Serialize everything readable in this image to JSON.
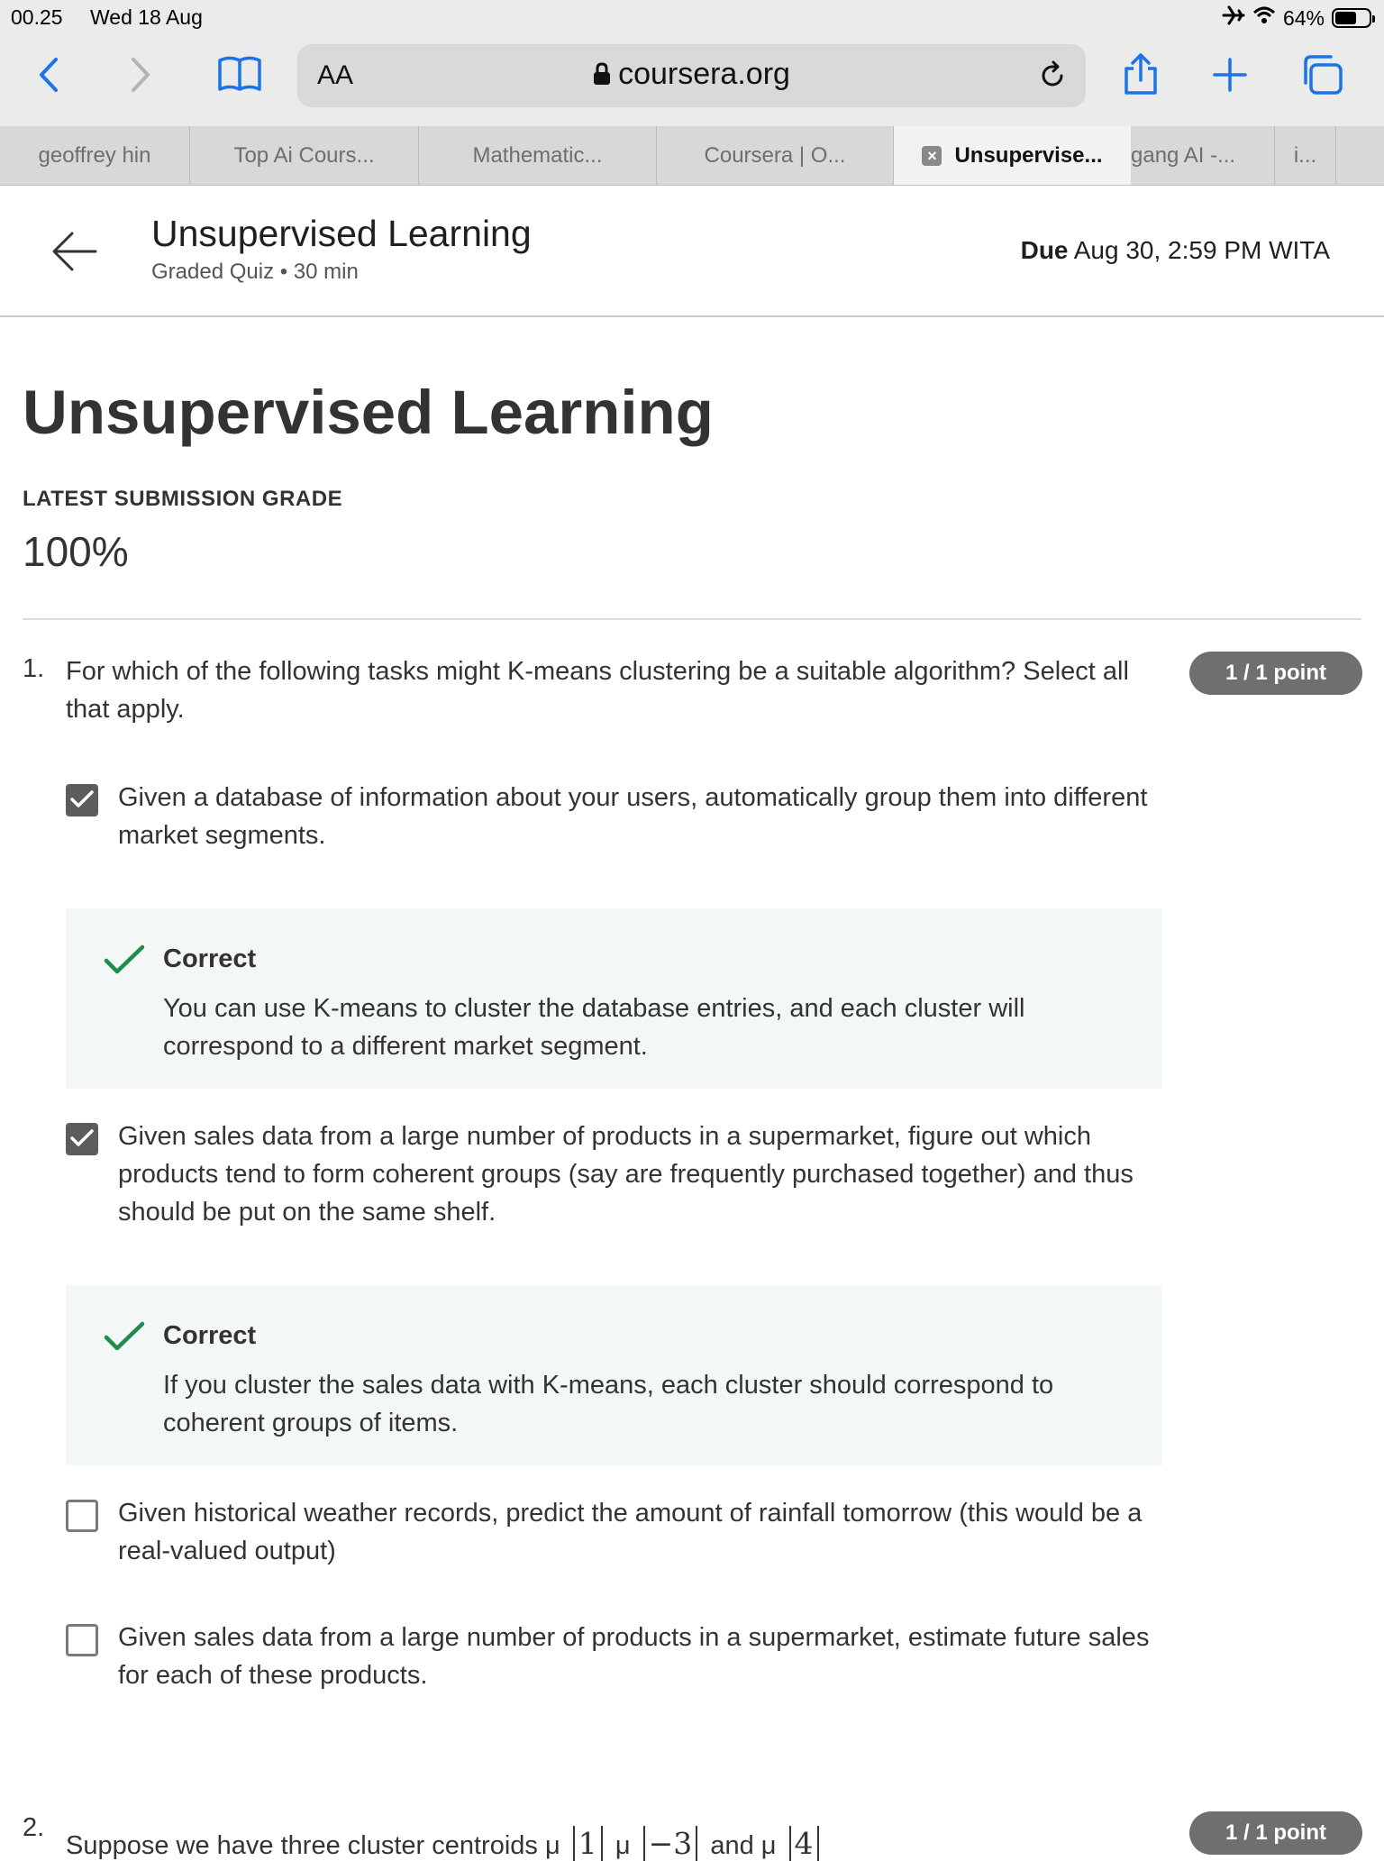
{
  "status_bar": {
    "time": "00.25",
    "date": "Wed 18 Aug",
    "battery": "64%",
    "battery_level": 0.64
  },
  "browser": {
    "aa_label": "AA",
    "url": "coursera.org",
    "tabs": [
      {
        "label": "geoffrey hin",
        "active": false
      },
      {
        "label": "Top Ai Cours...",
        "active": false
      },
      {
        "label": "Mathematic...",
        "active": false
      },
      {
        "label": "Coursera | O...",
        "active": false
      },
      {
        "label": "Unsupervise...",
        "active": true
      },
      {
        "label": "gang AI -...",
        "active": false
      },
      {
        "label": "i...",
        "active": false
      }
    ]
  },
  "header": {
    "title": "Unsupervised Learning",
    "subtitle": "Graded Quiz • 30 min",
    "due_label": "Due",
    "due_value": "Aug 30, 2:59 PM WITA"
  },
  "main": {
    "title": "Unsupervised Learning",
    "grade_label": "LATEST SUBMISSION GRADE",
    "grade_value": "100%"
  },
  "question1": {
    "number": "1.",
    "text": "For which of the following tasks might K-means clustering be a suitable algorithm? Select all that apply.",
    "points": "1 / 1 point",
    "options": [
      {
        "text": "Given a database of information about your users, automatically group them into different market segments.",
        "checked": true
      },
      {
        "text": "Given sales data from a large number of products in a supermarket, figure out which products tend to form coherent groups (say are frequently purchased together) and thus should be put on the same shelf.",
        "checked": true
      },
      {
        "text": "Given historical weather records, predict the amount of rainfall tomorrow (this would be a real-valued output)",
        "checked": false
      },
      {
        "text": "Given sales data from a large number of products in a supermarket, estimate future sales for each of these products.",
        "checked": false
      }
    ],
    "feedback": [
      {
        "title": "Correct",
        "text": "You can use K-means to cluster the database entries, and each cluster will correspond to a different market segment."
      },
      {
        "title": "Correct",
        "text": "If you cluster the sales data with K-means, each cluster should correspond to coherent groups of items."
      }
    ]
  },
  "question2": {
    "number": "2.",
    "text_start": "Suppose we have three cluster centroids μ",
    "matrix_1": "1",
    "matrix_2": "−3",
    "word_and": "and",
    "matrix_3": "4",
    "points": "1 / 1 point"
  }
}
